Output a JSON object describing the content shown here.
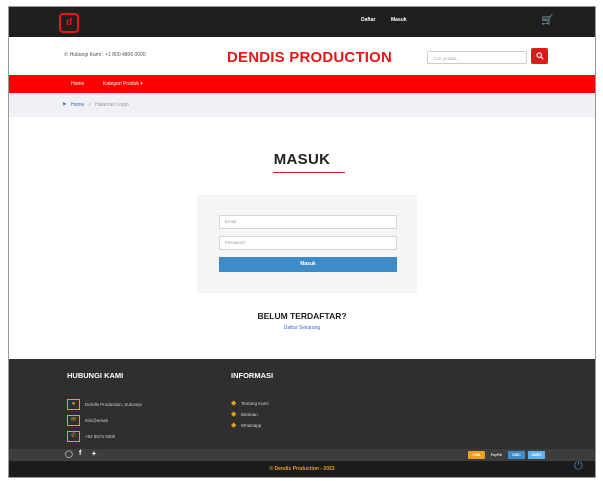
{
  "topbar": {
    "logo": "d",
    "links": {
      "daftar": "Daftar",
      "masuk": "Masuk"
    }
  },
  "header": {
    "phone": "Hubungi Kami : +1 800 4806 0000",
    "brand": "DENDIS PRODUCTION",
    "search_placeholder": "Cari produk..."
  },
  "nav": {
    "items": [
      {
        "label": "Home"
      },
      {
        "label": "Kategori Produk ▾"
      }
    ]
  },
  "breadcrumb": {
    "home": "Home",
    "sep": "/",
    "current": "Halaman Login"
  },
  "login": {
    "title": "MASUK",
    "email_placeholder": "Email",
    "password_placeholder": "Password",
    "submit": "Masuk",
    "register_heading": "BELUM TERDAFTAR?",
    "register_link": "Daftar Sekarang"
  },
  "footer": {
    "contact": {
      "heading": "HUBUNGI KAMI",
      "items": [
        {
          "icon": "map-marker-icon",
          "text": "Dendis Production, Sukorejo"
        },
        {
          "icon": "envelope-icon",
          "text": "info@email"
        },
        {
          "icon": "phone-icon",
          "text": "+62 8574 0000"
        }
      ]
    },
    "info": {
      "heading": "INFORMASI",
      "items": [
        {
          "text": "Tentang Kami"
        },
        {
          "text": "Bantuan"
        },
        {
          "text": "Whatsapp"
        }
      ]
    },
    "payments": [
      "VISA",
      "PayPal",
      "DISC",
      "AMEX"
    ],
    "copyright": "© Dendis Production - 2023"
  },
  "colors": {
    "accent_red": "#ff0000",
    "brand_red": "#e01818",
    "button_blue": "#3d8bc9",
    "footer_dark": "#2f2f2f",
    "footer_accent": "#e8a020"
  }
}
